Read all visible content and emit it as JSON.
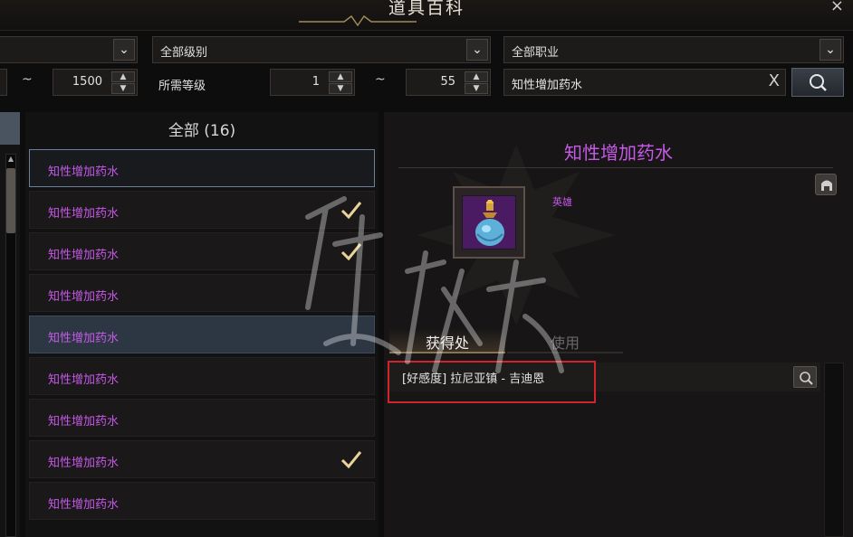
{
  "window": {
    "title": "道具百科",
    "close_glyph": "×"
  },
  "filters": {
    "grade_select": {
      "value": "全部级别"
    },
    "class_select": {
      "value": "全部职业"
    },
    "item_level": {
      "max": "1500"
    },
    "required_level_label": "所需等级",
    "required_level": {
      "min": "1",
      "max": "55"
    },
    "range_separator": "~",
    "search": {
      "value": "知性增加药水",
      "clear_glyph": "X"
    }
  },
  "list": {
    "header": "全部 (16)",
    "items": [
      {
        "label": "知性增加药水",
        "checked": false
      },
      {
        "label": "知性增加药水",
        "checked": true
      },
      {
        "label": "知性增加药水",
        "checked": true
      },
      {
        "label": "知性增加药水",
        "checked": false
      },
      {
        "label": "知性增加药水",
        "checked": false
      },
      {
        "label": "知性增加药水",
        "checked": false
      },
      {
        "label": "知性增加药水",
        "checked": false
      },
      {
        "label": "知性增加药水",
        "checked": true
      },
      {
        "label": "知性增加药水",
        "checked": false
      }
    ]
  },
  "detail": {
    "item_name": "知性增加药水",
    "grade": "英雄",
    "tabs": [
      {
        "label": "获得处"
      },
      {
        "label": "使用"
      }
    ],
    "sources": [
      {
        "text": "[好感度] 拉尼亚镇 - 吉迪恩"
      }
    ]
  },
  "colors": {
    "hero_purple": "#c659e8",
    "highlight_box": "#d0242a",
    "selected_row": "#2d3744"
  },
  "icons": [
    "chevron-down-icon",
    "spin-up-icon",
    "spin-down-icon",
    "clear-icon",
    "search-icon",
    "check-icon",
    "potion-icon",
    "helmet-icon",
    "close-icon"
  ]
}
